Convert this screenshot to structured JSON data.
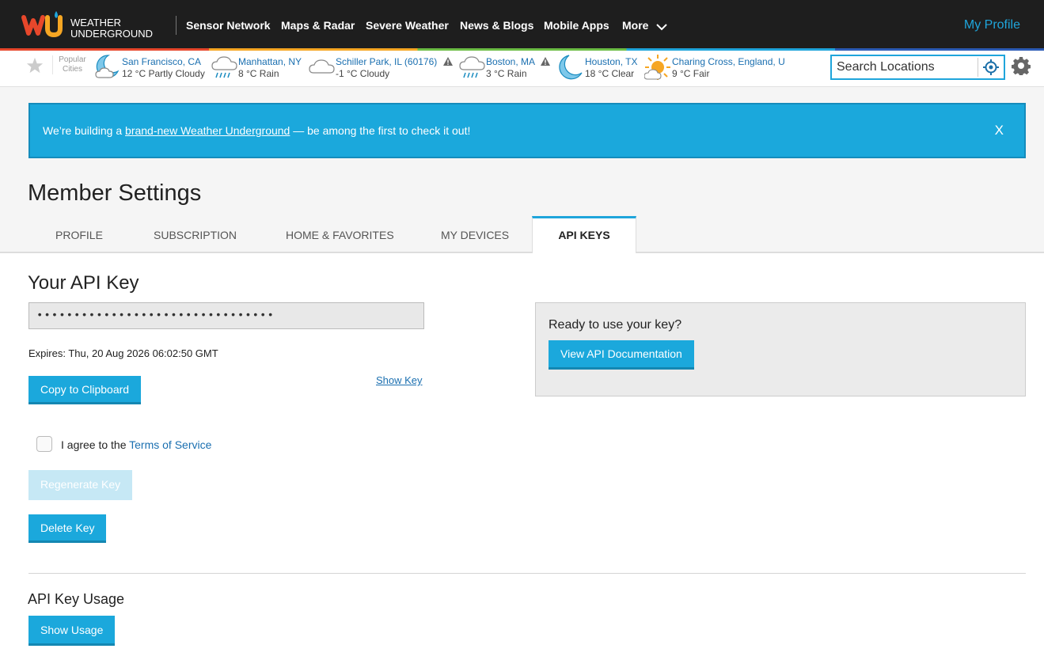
{
  "header": {
    "logo_text_line1": "WEATHER",
    "logo_text_line2": "UNDERGROUND",
    "nav": [
      "Sensor Network",
      "Maps & Radar",
      "Severe Weather",
      "News & Blogs",
      "Mobile Apps",
      "More"
    ],
    "my_profile": "My Profile"
  },
  "popular_cities": {
    "label_line1": "Popular",
    "label_line2": "Cities",
    "cities": [
      {
        "name": "San Francisco, CA",
        "conditions": "12 °C Partly Cloudy",
        "icon": "partly-cloudy-night-icon",
        "alert": false
      },
      {
        "name": "Manhattan, NY",
        "conditions": "8 °C Rain",
        "icon": "rain-icon",
        "alert": false
      },
      {
        "name": "Schiller Park, IL (60176)",
        "conditions": "-1 °C Cloudy",
        "icon": "cloudy-icon",
        "alert": true
      },
      {
        "name": "Boston, MA",
        "conditions": "3 °C Rain",
        "icon": "rain-icon",
        "alert": true
      },
      {
        "name": "Houston, TX",
        "conditions": "18 °C Clear",
        "icon": "clear-night-icon",
        "alert": false
      },
      {
        "name": "Charing Cross, England, U",
        "conditions": "9 °C Fair",
        "icon": "fair-day-icon",
        "alert": false
      }
    ]
  },
  "search": {
    "placeholder": "Search Locations"
  },
  "banner": {
    "prefix": "We’re building a ",
    "link": "brand-new Weather Underground",
    "suffix": " — be among the first to check it out!",
    "close": "X"
  },
  "page": {
    "title": "Member Settings",
    "tabs": [
      "PROFILE",
      "SUBSCRIPTION",
      "HOME & FAVORITES",
      "MY DEVICES",
      "API KEYS"
    ],
    "active_tab": "API KEYS"
  },
  "api_key": {
    "heading": "Your API Key",
    "masked_value": "••••••••••••••••••••••••••••••••",
    "expires": "Expires: Thu, 20 Aug 2026 06:02:50 GMT",
    "show_key": "Show Key",
    "copy_button": "Copy to Clipboard",
    "agree_prefix": "I agree to the ",
    "terms_link": "Terms of Service",
    "terms_checked": false,
    "regenerate_button": "Regenerate Key",
    "delete_button": "Delete Key"
  },
  "ready": {
    "text": "Ready to use your key?",
    "button": "View API Documentation"
  },
  "usage": {
    "heading": "API Key Usage",
    "button": "Show Usage"
  },
  "colors": {
    "accent": "#1ba8dc",
    "nav_bg": "#1e1e1e",
    "link": "#1a6fb0"
  }
}
